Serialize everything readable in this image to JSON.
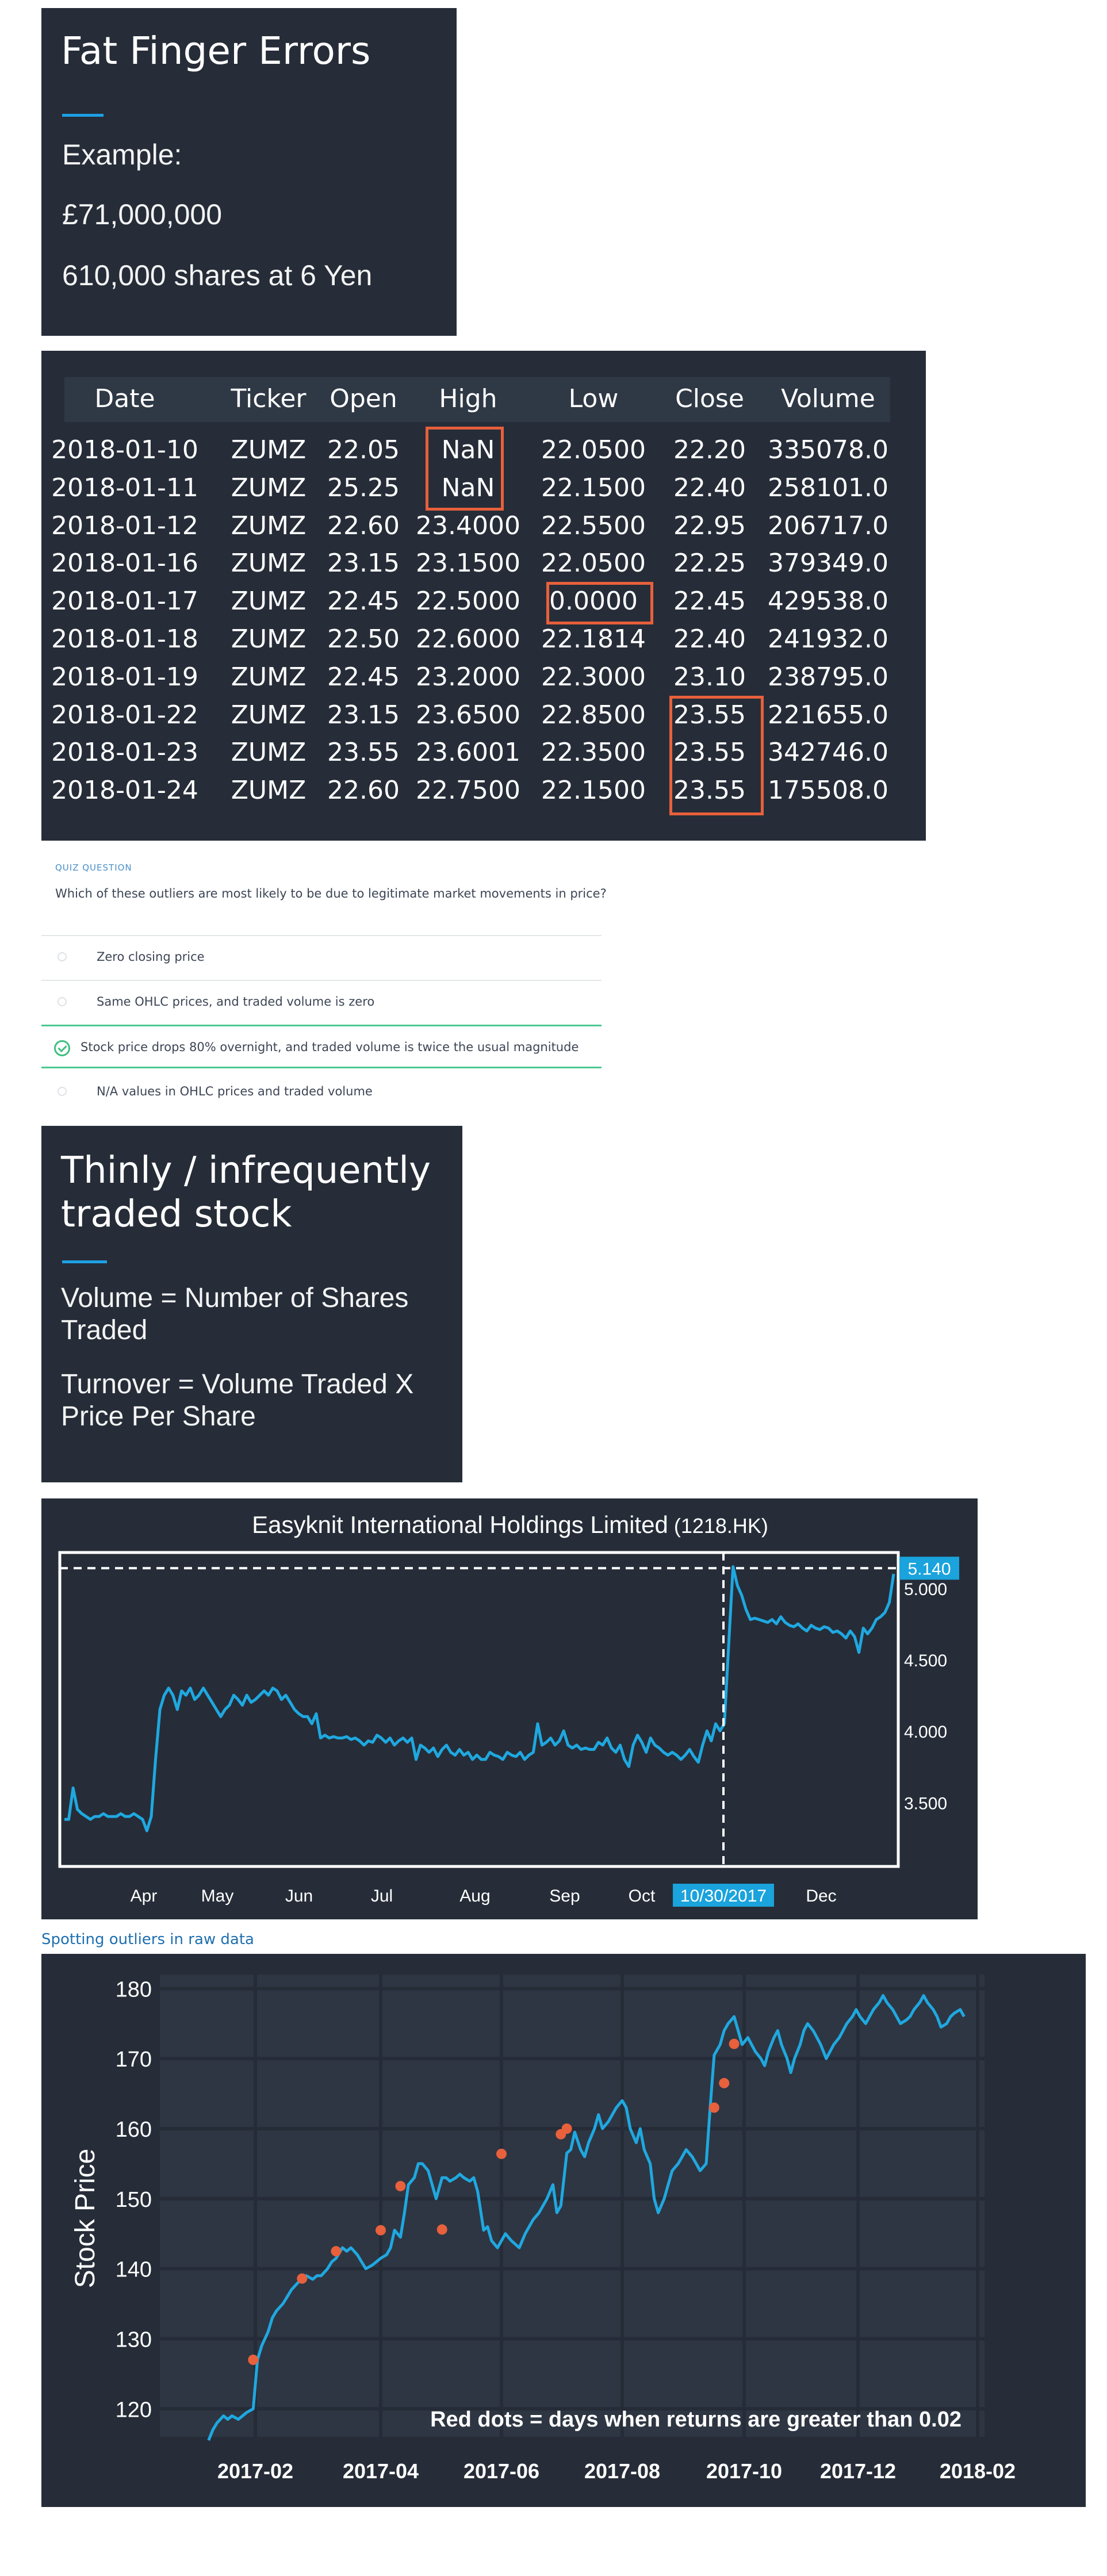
{
  "slide1": {
    "title": "Fat Finger Errors",
    "lines": [
      "Example:",
      "£71,000,000",
      "610,000 shares at 6 Yen"
    ]
  },
  "table": {
    "headers": [
      "Date",
      "Ticker",
      "Open",
      "High",
      "Low",
      "Close",
      "Volume"
    ],
    "rows": [
      [
        "2018-01-10",
        "ZUMZ",
        "22.05",
        "NaN",
        "22.0500",
        "22.20",
        "335078.0"
      ],
      [
        "2018-01-11",
        "ZUMZ",
        "25.25",
        "NaN",
        "22.1500",
        "22.40",
        "258101.0"
      ],
      [
        "2018-01-12",
        "ZUMZ",
        "22.60",
        "23.4000",
        "22.5500",
        "22.95",
        "206717.0"
      ],
      [
        "2018-01-16",
        "ZUMZ",
        "23.15",
        "23.1500",
        "22.0500",
        "22.25",
        "379349.0"
      ],
      [
        "2018-01-17",
        "ZUMZ",
        "22.45",
        "22.5000",
        "0.0000",
        "22.45",
        "429538.0"
      ],
      [
        "2018-01-18",
        "ZUMZ",
        "22.50",
        "22.6000",
        "22.1814",
        "22.40",
        "241932.0"
      ],
      [
        "2018-01-19",
        "ZUMZ",
        "22.45",
        "23.2000",
        "22.3000",
        "23.10",
        "238795.0"
      ],
      [
        "2018-01-22",
        "ZUMZ",
        "23.15",
        "23.6500",
        "22.8500",
        "23.55",
        "221655.0"
      ],
      [
        "2018-01-23",
        "ZUMZ",
        "23.55",
        "23.6001",
        "22.3500",
        "23.55",
        "342746.0"
      ],
      [
        "2018-01-24",
        "ZUMZ",
        "22.60",
        "22.7500",
        "22.1500",
        "23.55",
        "175508.0"
      ]
    ]
  },
  "quiz": {
    "label": "QUIZ QUESTION",
    "question": "Which of these outliers are most likely to be due to legitimate market movements in price?",
    "options": [
      {
        "text": "Zero closing price",
        "correct": false
      },
      {
        "text": "Same OHLC prices, and traded volume is zero",
        "correct": false
      },
      {
        "text": "Stock price drops 80% overnight, and traded volume is twice the usual magnitude",
        "correct": true
      },
      {
        "text": "N/A values in OHLC prices and traded volume",
        "correct": false
      }
    ]
  },
  "slide2": {
    "title_lines": [
      "Thinly / infrequently",
      "traded stock"
    ],
    "para1": [
      "Volume = Number of Shares",
      "Traded"
    ],
    "para2": [
      "Turnover = Volume Traded X",
      "Price Per Share"
    ]
  },
  "caption": "Spotting outliers in raw data",
  "colors": {
    "panel": "#262d38",
    "accent": "#1da1e6",
    "highlight": "#e8603c",
    "correct": "#3fbf7f",
    "line": "#1fa8e0",
    "dot": "#e8603c"
  },
  "chart_data": [
    {
      "type": "line",
      "title": "Easyknit International Holdings Limited",
      "subtitle": "(1218.HK)",
      "x_labels": [
        "Apr",
        "May",
        "Jun",
        "Jul",
        "Aug",
        "Sep",
        "Oct",
        "10/30/2017",
        "Dec"
      ],
      "y_ticks": [
        3.5,
        4.0,
        4.5,
        5.0
      ],
      "y_tick_labels": [
        "3.500",
        "4.000",
        "4.500",
        "5.000"
      ],
      "ylim": [
        3.05,
        5.25
      ],
      "highlight_value": "5.140",
      "highlight_date": "10/30/2017",
      "values": [
        3.38,
        3.38,
        3.6,
        3.45,
        3.42,
        3.4,
        3.38,
        3.4,
        3.4,
        3.42,
        3.4,
        3.4,
        3.4,
        3.42,
        3.4,
        3.4,
        3.42,
        3.4,
        3.38,
        3.3,
        3.4,
        3.8,
        4.15,
        4.25,
        4.3,
        4.25,
        4.15,
        4.28,
        4.25,
        4.3,
        4.22,
        4.25,
        4.3,
        4.25,
        4.2,
        4.15,
        4.1,
        4.15,
        4.18,
        4.25,
        4.22,
        4.18,
        4.25,
        4.2,
        4.22,
        4.25,
        4.28,
        4.25,
        4.3,
        4.28,
        4.22,
        4.25,
        4.2,
        4.15,
        4.12,
        4.1,
        4.1,
        4.05,
        4.12,
        3.95,
        3.97,
        3.95,
        3.96,
        3.95,
        3.95,
        3.96,
        3.94,
        3.95,
        3.93,
        3.9,
        3.93,
        3.92,
        3.97,
        3.95,
        3.92,
        3.95,
        3.9,
        3.93,
        3.95,
        3.92,
        3.95,
        3.8,
        3.9,
        3.88,
        3.85,
        3.88,
        3.82,
        3.87,
        3.9,
        3.85,
        3.83,
        3.87,
        3.83,
        3.85,
        3.8,
        3.83,
        3.8,
        3.8,
        3.85,
        3.83,
        3.82,
        3.8,
        3.85,
        3.83,
        3.82,
        3.85,
        3.8,
        3.83,
        3.85,
        4.05,
        3.9,
        3.92,
        3.95,
        3.9,
        3.93,
        4.0,
        3.9,
        3.88,
        3.9,
        3.87,
        3.88,
        3.87,
        3.87,
        3.92,
        3.9,
        3.95,
        3.88,
        3.85,
        3.9,
        3.8,
        3.75,
        3.9,
        3.97,
        3.92,
        3.85,
        3.95,
        3.9,
        3.88,
        3.85,
        3.83,
        3.85,
        3.83,
        3.8,
        3.83,
        3.87,
        3.82,
        3.78,
        3.9,
        4.0,
        3.93,
        4.05,
        4.0,
        4.05,
        4.6,
        5.15,
        5.02,
        4.95,
        4.85,
        4.78,
        4.79,
        4.78,
        4.77,
        4.76,
        4.78,
        4.75,
        4.8,
        4.76,
        4.74,
        4.73,
        4.75,
        4.72,
        4.7,
        4.74,
        4.72,
        4.71,
        4.73,
        4.72,
        4.69,
        4.7,
        4.68,
        4.65,
        4.7,
        4.66,
        4.55,
        4.72,
        4.68,
        4.72,
        4.78,
        4.8,
        4.83,
        4.9,
        5.1
      ]
    },
    {
      "type": "line",
      "xlabel": "",
      "ylabel": "Stock Price",
      "x_labels": [
        "2017-02",
        "2017-04",
        "2017-06",
        "2017-08",
        "2017-10",
        "2017-12",
        "2018-02"
      ],
      "y_ticks": [
        120,
        130,
        140,
        150,
        160,
        170,
        180
      ],
      "ylim": [
        116,
        182
      ],
      "annotation": "Red dots = days when returns are greater than 0.02",
      "grid": true,
      "x": [
        "2017-01-10",
        "2017-01-12",
        "2017-01-14",
        "2017-01-17",
        "2017-01-19",
        "2017-01-21",
        "2017-01-24",
        "2017-01-26",
        "2017-01-28",
        "2017-01-31",
        "2017-02-02",
        "2017-02-04",
        "2017-02-07",
        "2017-02-09",
        "2017-02-11",
        "2017-02-14",
        "2017-02-16",
        "2017-02-18",
        "2017-02-21",
        "2017-02-23",
        "2017-02-25",
        "2017-02-28",
        "2017-03-02",
        "2017-03-04",
        "2017-03-07",
        "2017-03-09",
        "2017-03-11",
        "2017-03-14",
        "2017-03-16",
        "2017-03-18",
        "2017-03-21",
        "2017-03-23",
        "2017-03-25",
        "2017-03-28",
        "2017-03-30",
        "2017-04-01",
        "2017-04-04",
        "2017-04-06",
        "2017-04-08",
        "2017-04-11",
        "2017-04-13",
        "2017-04-15",
        "2017-04-18",
        "2017-04-20",
        "2017-04-22",
        "2017-04-25",
        "2017-04-27",
        "2017-04-29",
        "2017-05-02",
        "2017-05-04",
        "2017-05-06",
        "2017-05-09",
        "2017-05-11",
        "2017-05-13",
        "2017-05-16",
        "2017-05-18",
        "2017-05-20",
        "2017-05-23",
        "2017-05-25",
        "2017-05-27",
        "2017-05-30",
        "2017-06-01",
        "2017-06-03",
        "2017-06-06",
        "2017-06-08",
        "2017-06-10",
        "2017-06-13",
        "2017-06-15",
        "2017-06-17",
        "2017-06-20",
        "2017-06-22",
        "2017-06-24",
        "2017-06-27",
        "2017-06-29",
        "2017-07-01",
        "2017-07-04",
        "2017-07-06",
        "2017-07-08",
        "2017-07-11",
        "2017-07-13",
        "2017-07-15",
        "2017-07-18",
        "2017-07-20",
        "2017-07-22",
        "2017-07-25",
        "2017-07-27",
        "2017-07-29",
        "2017-08-01",
        "2017-08-03",
        "2017-08-05",
        "2017-08-08",
        "2017-08-10",
        "2017-08-12",
        "2017-08-15",
        "2017-08-17",
        "2017-08-19",
        "2017-08-22",
        "2017-08-24",
        "2017-08-26",
        "2017-08-29",
        "2017-08-31",
        "2017-09-02",
        "2017-09-05",
        "2017-09-07",
        "2017-09-09",
        "2017-09-12",
        "2017-09-14",
        "2017-09-16",
        "2017-09-19",
        "2017-09-21",
        "2017-09-23",
        "2017-09-26",
        "2017-09-28",
        "2017-09-30",
        "2017-10-03",
        "2017-10-05",
        "2017-10-07",
        "2017-10-10",
        "2017-10-12",
        "2017-10-14",
        "2017-10-17",
        "2017-10-19",
        "2017-10-21",
        "2017-10-24",
        "2017-10-26",
        "2017-10-28",
        "2017-10-31",
        "2017-11-02",
        "2017-11-04",
        "2017-11-07",
        "2017-11-09",
        "2017-11-11",
        "2017-11-14",
        "2017-11-16",
        "2017-11-18",
        "2017-11-21",
        "2017-11-23",
        "2017-11-25",
        "2017-11-28",
        "2017-11-30",
        "2017-12-02",
        "2017-12-05",
        "2017-12-07",
        "2017-12-09",
        "2017-12-12",
        "2017-12-14",
        "2017-12-16",
        "2017-12-19",
        "2017-12-21",
        "2017-12-23",
        "2017-12-26",
        "2017-12-28",
        "2017-12-30",
        "2018-01-02",
        "2018-01-04",
        "2018-01-06",
        "2018-01-09",
        "2018-01-11",
        "2018-01-13",
        "2018-01-16",
        "2018-01-18",
        "2018-01-20",
        "2018-01-23",
        "2018-01-25"
      ],
      "values": [
        115.5,
        117,
        118,
        119,
        118.5,
        119,
        118.5,
        119,
        119.5,
        120,
        127,
        129,
        131,
        133,
        134,
        135,
        136,
        137,
        138,
        138.5,
        139,
        138.5,
        139,
        139,
        140,
        141,
        141.5,
        143,
        142.5,
        143,
        142,
        141,
        140,
        140.5,
        141,
        141.5,
        142,
        143,
        145.5,
        144.5,
        148,
        152,
        153,
        155,
        155,
        154,
        152,
        150,
        153,
        153,
        152.5,
        153,
        153.5,
        153,
        152.5,
        153,
        151,
        145.5,
        146,
        144,
        143,
        144,
        145,
        144,
        143.5,
        143,
        145,
        146,
        147,
        148,
        149,
        150,
        152,
        148,
        149,
        156.5,
        157,
        159.5,
        157,
        156,
        158,
        160,
        162,
        160,
        161,
        162,
        163,
        164,
        163,
        160,
        158,
        160,
        157,
        155,
        150,
        148,
        150,
        152,
        154,
        155,
        156,
        157,
        156,
        155,
        154,
        155,
        163,
        170.5,
        172,
        174,
        175,
        176,
        174,
        172,
        173,
        172,
        171,
        170,
        169,
        171,
        173,
        174,
        172,
        170,
        168,
        170,
        172,
        174,
        175,
        174,
        173,
        172,
        170,
        171,
        172,
        173,
        174,
        175,
        176,
        177,
        176,
        175,
        176,
        177,
        178,
        179,
        178,
        177,
        176,
        175,
        175.5,
        176,
        177,
        178,
        179,
        178,
        177,
        176,
        174.5,
        175,
        176,
        176.5,
        177,
        176,
        175,
        174.5,
        174.2
      ],
      "outlier_dates": [
        "2017-01-31",
        "2017-02-23",
        "2017-03-11",
        "2017-04-01",
        "2017-04-11",
        "2017-05-02",
        "2017-06-01",
        "2017-07-01",
        "2017-07-04",
        "2017-09-16",
        "2017-09-21",
        "2017-09-26"
      ],
      "outlier_values": [
        127,
        138.6,
        142.5,
        145.5,
        151.8,
        145.6,
        156.4,
        159.2,
        160,
        163,
        166.5,
        172.1
      ]
    }
  ]
}
